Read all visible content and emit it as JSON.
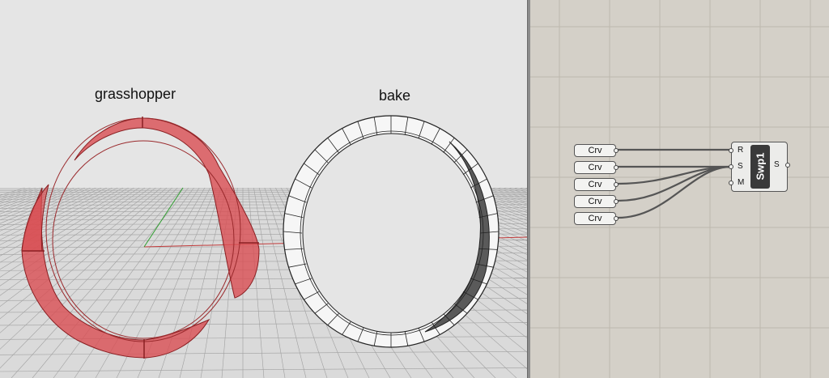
{
  "viewport": {
    "label_left": "grasshopper",
    "label_right": "bake",
    "colors": {
      "background": "#e5e5e5",
      "grid": "#9a9a9a",
      "x_axis": "#c23b3b",
      "y_axis": "#2f9e2f",
      "preview": "#d94e52",
      "baked": "#222222"
    }
  },
  "canvas": {
    "curve_params": [
      {
        "label": "Crv"
      },
      {
        "label": "Crv"
      },
      {
        "label": "Crv"
      },
      {
        "label": "Crv"
      },
      {
        "label": "Crv"
      }
    ],
    "sweep_component": {
      "name": "Swp1",
      "inputs": [
        {
          "label": "R"
        },
        {
          "label": "S"
        },
        {
          "label": "M"
        }
      ],
      "output": "S"
    },
    "colors": {
      "background": "#d4d0c8",
      "grid": "#bdb8ae",
      "wire": "#555555"
    }
  }
}
